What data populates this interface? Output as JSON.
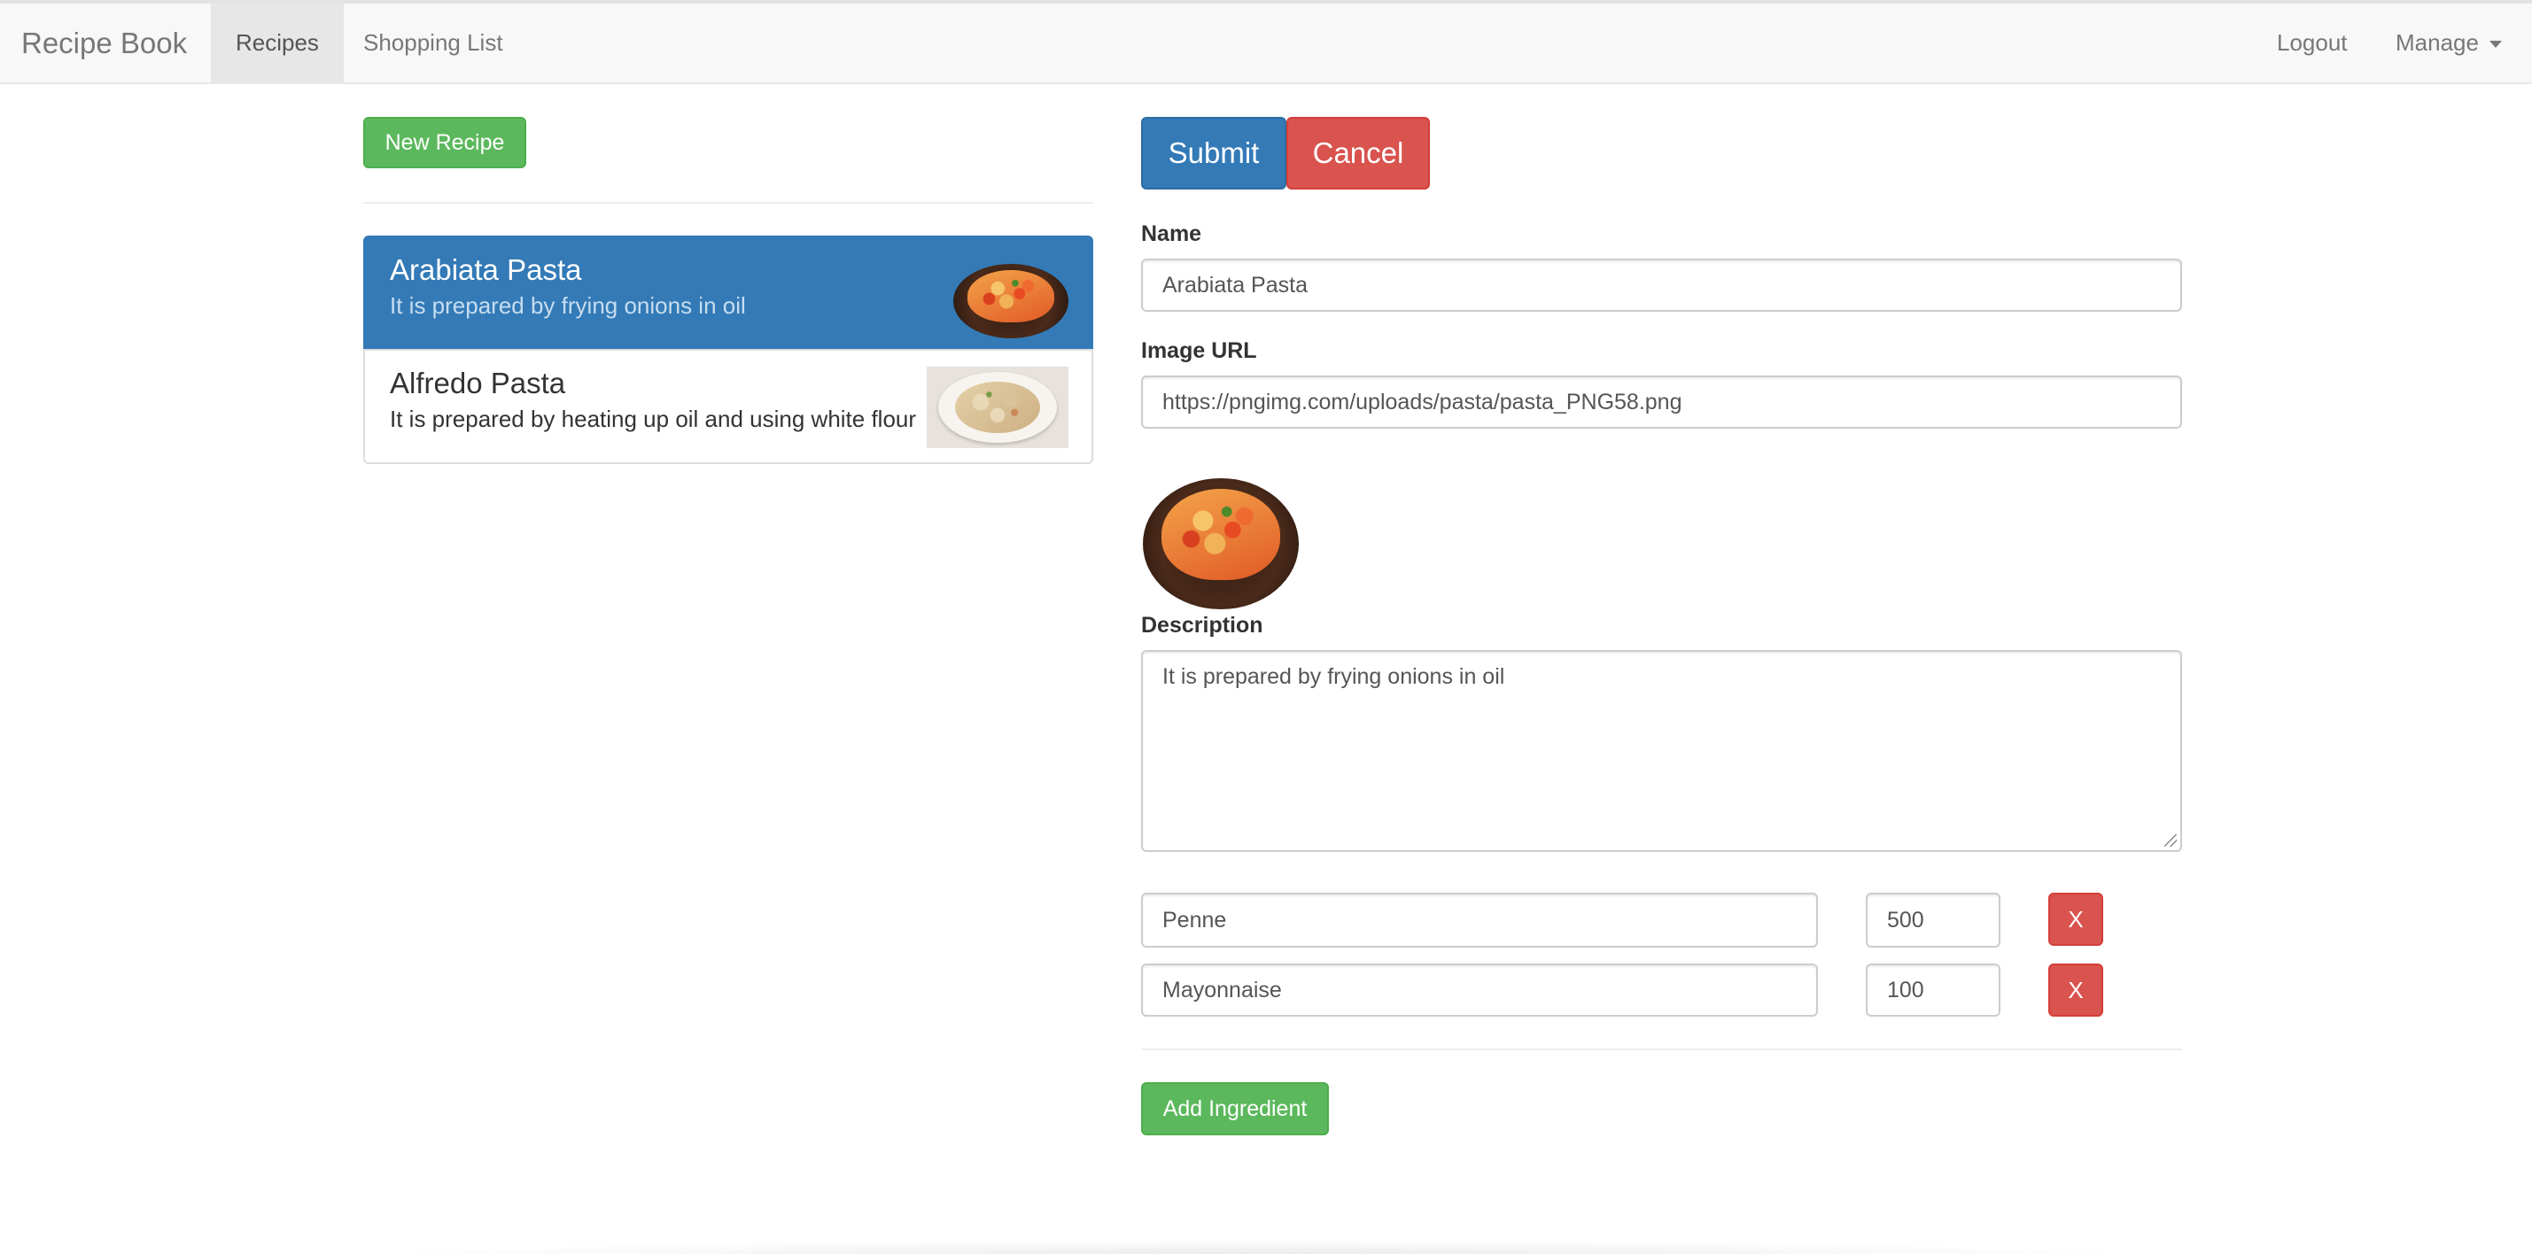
{
  "navbar": {
    "brand": "Recipe Book",
    "items": [
      {
        "label": "Recipes",
        "active": true
      },
      {
        "label": "Shopping List",
        "active": false
      }
    ],
    "logout": "Logout",
    "manage": "Manage"
  },
  "recipes": {
    "new_button": "New Recipe",
    "list": [
      {
        "name": "Arabiata Pasta",
        "description": "It is prepared by frying onions in oil",
        "active": true
      },
      {
        "name": "Alfredo Pasta",
        "description": "It is prepared by heating up oil and using white flour",
        "active": false
      }
    ]
  },
  "form": {
    "submit": "Submit",
    "cancel": "Cancel",
    "name_label": "Name",
    "name_value": "Arabiata Pasta",
    "image_label": "Image URL",
    "image_value": "https://pngimg.com/uploads/pasta/pasta_PNG58.png",
    "description_label": "Description",
    "description_value": "It is prepared by frying onions in oil",
    "ingredients": [
      {
        "name": "Penne",
        "amount": "500",
        "remove": "X"
      },
      {
        "name": "Mayonnaise",
        "amount": "100",
        "remove": "X"
      }
    ],
    "add_ingredient": "Add Ingredient"
  },
  "colors": {
    "primary": "#337ab7",
    "success": "#5cb85c",
    "danger": "#d9534f"
  }
}
